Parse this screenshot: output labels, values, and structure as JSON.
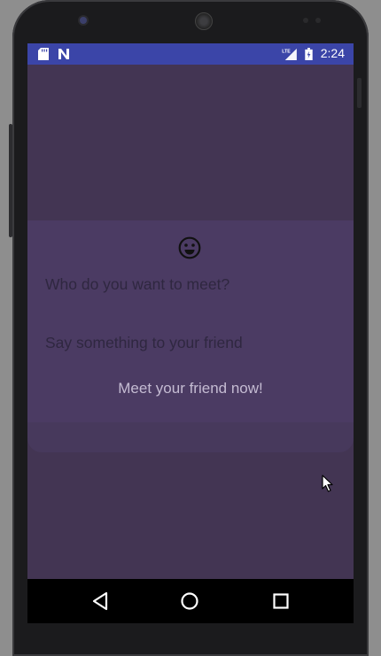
{
  "status_bar": {
    "time": "2:24",
    "left_icons": [
      "sd-card-icon",
      "n-notification-icon"
    ],
    "right_icons": [
      "lte-signal-icon",
      "battery-icon"
    ]
  },
  "form": {
    "emoji_icon": "smile-face-icon",
    "meet_field_placeholder": "Who do you want to meet?",
    "message_field_placeholder": "Say something to your friend",
    "submit_label": "Meet your friend now!"
  },
  "nav_bar": {
    "icons": [
      "back-icon",
      "home-icon",
      "recents-icon"
    ]
  },
  "colors": {
    "status_bar": "#3b45a8",
    "background": "#433553",
    "card": "#4b3b63",
    "nav_bar": "#000000"
  }
}
